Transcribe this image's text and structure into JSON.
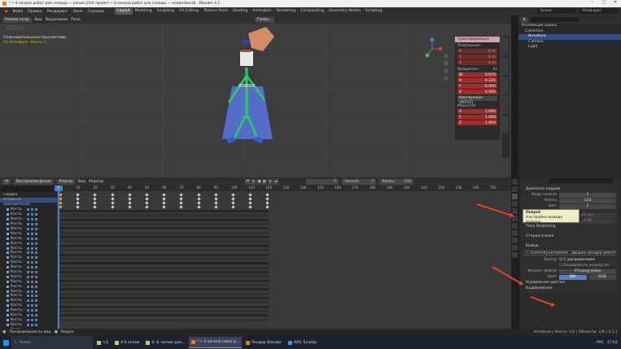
{
  "window": {
    "title": "* • 4 начало робот для сплеша — копия (2)\\4 проект\\ • 4 начало робот для сплеша — копия.blend] - Blender 4.1"
  },
  "menu": {
    "items": [
      "Файл",
      "Правка",
      "Рендеринг",
      "Окно",
      "Справка"
    ],
    "tabs": [
      "Layout",
      "Modeling",
      "Sculpting",
      "UV Editing",
      "Texture Paint",
      "Shading",
      "Animation",
      "Rendering",
      "Compositing",
      "Geometry Nodes",
      "Scripting"
    ],
    "active_tab": "Layout",
    "scene": "Scene",
    "view_layer": "ViewLayer"
  },
  "viewport": {
    "header": [
      "Режим позы",
      "Вид",
      "Выделение",
      "Поза"
    ],
    "header_right": [
      "Глоба..."
    ],
    "info_title": "Пользовательская перспектива",
    "info_sub": "(1) Armature : Кость 1"
  },
  "npanel": {
    "title": "Трансформация",
    "loc_label": "Положение:",
    "loc": [
      {
        "axis": "X",
        "val": "0 m"
      },
      {
        "axis": "Y",
        "val": "0 m"
      },
      {
        "axis": "Z",
        "val": "0 m"
      }
    ],
    "rot_label": "Вращение:",
    "rot_mode": "4L",
    "rot": [
      {
        "axis": "W",
        "val": "0.974"
      },
      {
        "axis": "X",
        "val": "0.226"
      },
      {
        "axis": "Y",
        "val": "-0.000"
      },
      {
        "axis": "Z",
        "val": "0.000"
      }
    ],
    "rot_type": "Кватернион (WXYZ)",
    "scale_label": "Масштаб:",
    "scale": [
      {
        "axis": "X",
        "val": "1.000"
      },
      {
        "axis": "Y",
        "val": "1.000"
      },
      {
        "axis": "Z",
        "val": "1.000"
      }
    ]
  },
  "timeline": {
    "header": [
      "Воспроизведение",
      "Ключи",
      "Вид",
      "Маркер"
    ],
    "frame": "1",
    "start_label": "Начало",
    "start": "1",
    "end_label": "Конец",
    "end": "120",
    "ruler": [
      "0",
      "10",
      "20",
      "30",
      "40",
      "50",
      "60",
      "70",
      "80",
      "90",
      "100",
      "110",
      "120",
      "130",
      "140",
      "150",
      "160",
      "170",
      "180",
      "190",
      "200",
      "210",
      "220",
      "230",
      "240",
      "250"
    ],
    "current_frame_label": "1"
  },
  "dope_outliner": {
    "search": "",
    "items": [
      "Сводка",
      "Armature",
      "Армaдиляция"
    ],
    "bone_label": "Кость"
  },
  "outliner": {
    "title": "Коллекция сцены",
    "items": [
      "Collection",
      "Armature",
      "Camera",
      "Light"
    ]
  },
  "properties": {
    "section_frames": "Диапазон кадров",
    "frame_start_label": "Кадр начала",
    "frame_start": "1",
    "end_label": "Конец",
    "end": "120",
    "step_label": "Шаг",
    "step": "1",
    "tooltip_title": "Output",
    "tooltip_body": "Настройки вывода файлов",
    "time_label": "Time Stretching",
    "stereo_label": "Стереоскопия",
    "fps_label": "Частота кадров",
    "fps_val": "24 fps",
    "base_label": "Основа",
    "base_val": "1.00",
    "output_label": "Вывод",
    "output_path": "C:\\Users\\Ilyusm\\Deskt...звышен рендер робот\\",
    "saving_label": "Saving",
    "ext_label": "С расширением",
    "cache_label": "Кэшировать результат",
    "format_label": "Формат файла",
    "format_val": "FFmpeg Video",
    "color_label": "Цвет",
    "bw": "BW",
    "rgb": "RGB",
    "color_mgmt": "Управление цветом",
    "encoding": "Кодирование"
  },
  "status": {
    "left": [
      "Панорамировать вид",
      "Region"
    ],
    "right": "Armature | Кости: 1/1 | Объекты: 1/4 | 4.1.1"
  },
  "taskbar": {
    "search": "Поиск",
    "tasks": [
      "ч.5",
      "4-5 копия",
      "4. 6. копия для...",
      "* • 4 начало robot д...",
      "Рендер Blender",
      "AVG TuneUp"
    ],
    "active_task": 3,
    "tray": [
      "РУС",
      "17:02"
    ]
  },
  "colors": {
    "accent": "#4a7fd0",
    "selected_key": "#f0a030",
    "arrow": "#e2412a",
    "tooltip": "#ededc6"
  }
}
